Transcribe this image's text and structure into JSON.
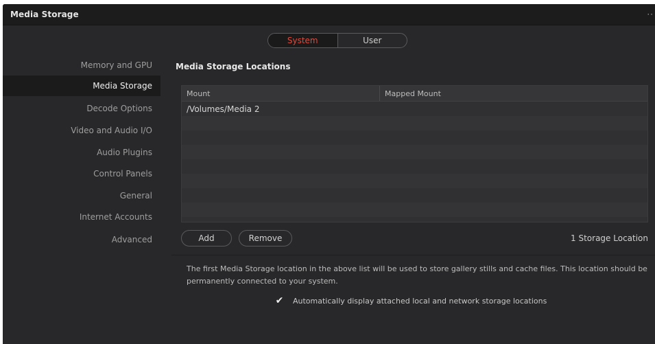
{
  "window": {
    "title": "Media Storage",
    "more_glyph": "··"
  },
  "scope_toggle": {
    "options": [
      "System",
      "User"
    ],
    "selected": "System",
    "accent_color": "#e24a3b"
  },
  "sidebar": {
    "items": [
      {
        "label": "Memory and GPU"
      },
      {
        "label": "Media Storage"
      },
      {
        "label": "Decode Options"
      },
      {
        "label": "Video and Audio I/O"
      },
      {
        "label": "Audio Plugins"
      },
      {
        "label": "Control Panels"
      },
      {
        "label": "General"
      },
      {
        "label": "Internet Accounts"
      },
      {
        "label": "Advanced"
      }
    ],
    "active": "Media Storage"
  },
  "main": {
    "section_title": "Media Storage Locations",
    "table": {
      "columns": [
        "Mount",
        "Mapped Mount"
      ],
      "rows": [
        [
          "/Volumes/Media 2",
          ""
        ]
      ]
    },
    "add_label": "Add",
    "remove_label": "Remove",
    "count_label": "1 Storage Location",
    "note": "The first Media Storage location in the above list will be used to store gallery stills and cache files. This location should be permanently connected to your system.",
    "auto_display": {
      "checked": true,
      "check_glyph": "✔",
      "label": "Automatically display attached local and network storage locations"
    }
  }
}
